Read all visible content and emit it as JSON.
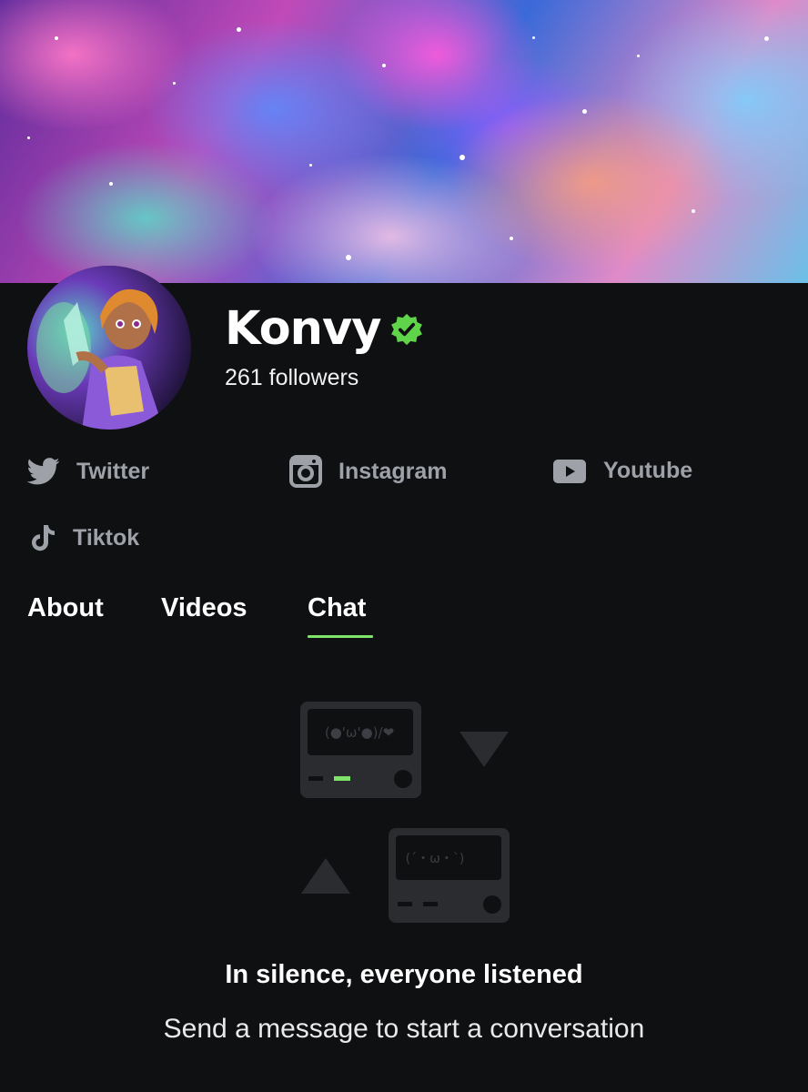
{
  "profile": {
    "name": "Konvy",
    "followers": "261 followers"
  },
  "socials": [
    {
      "label": "Twitter",
      "icon": "twitter-icon"
    },
    {
      "label": "Instagram",
      "icon": "instagram-icon"
    },
    {
      "label": "Youtube",
      "icon": "youtube-icon"
    },
    {
      "label": "Tiktok",
      "icon": "tiktok-icon"
    }
  ],
  "tabs": [
    {
      "label": "About",
      "active": false
    },
    {
      "label": "Videos",
      "active": false
    },
    {
      "label": "Chat",
      "active": true
    }
  ],
  "empty_state": {
    "screen1_text": "(●'ω'●)/❤",
    "screen2_text": "(ˊ・ω・ˋ)",
    "title": "In silence, everyone listened",
    "subtitle": "Send a message to start a conversation"
  },
  "colors": {
    "background": "#0f1012",
    "accent": "#7fe36a",
    "muted_text": "#9ea1a8",
    "illustration": "#2a2c30"
  }
}
